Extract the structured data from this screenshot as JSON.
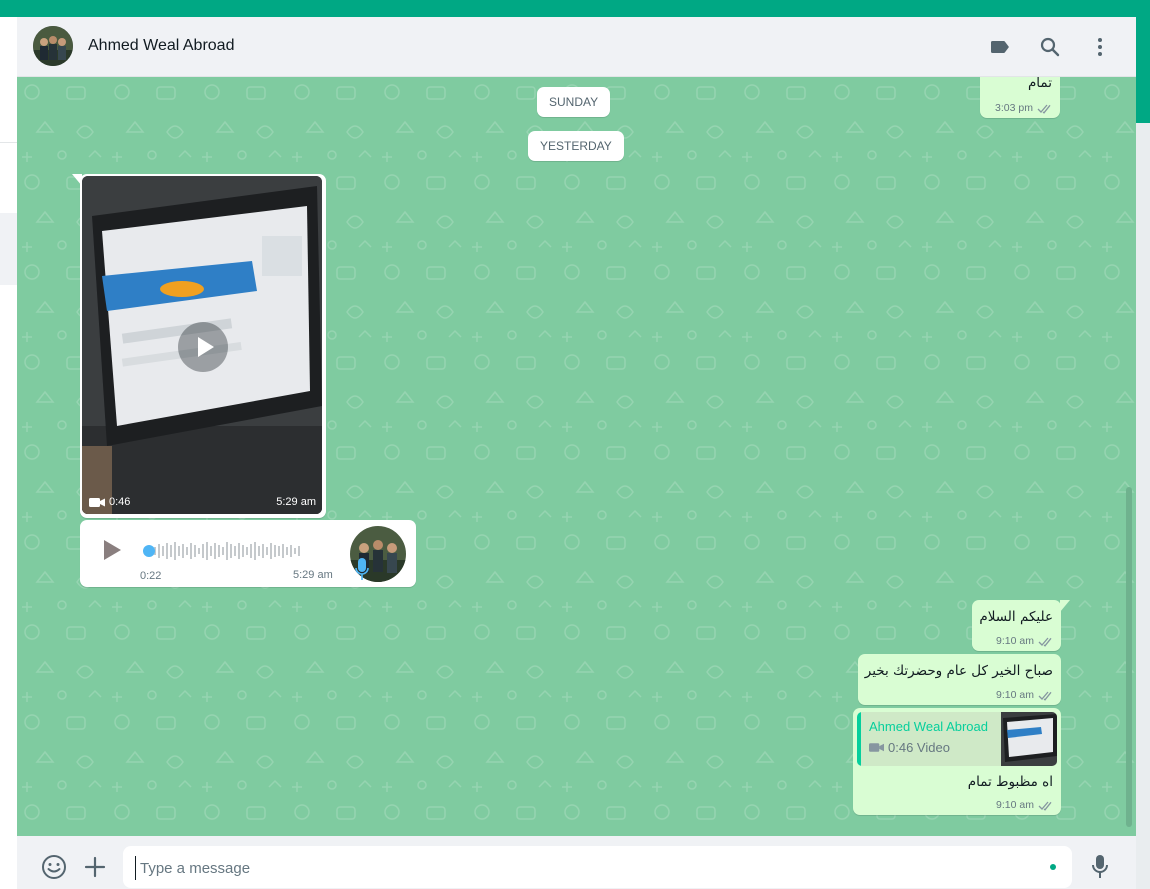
{
  "header": {
    "contact_name": "Ahmed Weal Abroad",
    "icons": [
      "label-icon",
      "search-icon",
      "menu-icon"
    ]
  },
  "colors": {
    "accent": "#00a884",
    "chat_bg": "#7fcba0",
    "outgoing_bubble": "#d9fdd3",
    "incoming_bubble": "#ffffff",
    "ticks": "#8696a0"
  },
  "messages": {
    "m1": {
      "text": "تمام",
      "time": "3:03 pm"
    },
    "date_sunday": "SUNDAY",
    "date_yesterday": "YESTERDAY",
    "video": {
      "duration": "0:46",
      "time": "5:29 am"
    },
    "voice": {
      "duration": "0:22",
      "time": "5:29 am",
      "progress": 0.0
    },
    "m2": {
      "text": "عليكم السلام",
      "time": "9:10 am"
    },
    "m3": {
      "text": "صباح الخير كل عام وحضرتك بخير",
      "time": "9:10 am"
    },
    "m4": {
      "quote_author": "Ahmed Weal Abroad",
      "quote_text": "0:46 Video",
      "text": "اه مظبوط تمام",
      "time": "9:10 am"
    }
  },
  "composer": {
    "placeholder": "Type a message"
  }
}
